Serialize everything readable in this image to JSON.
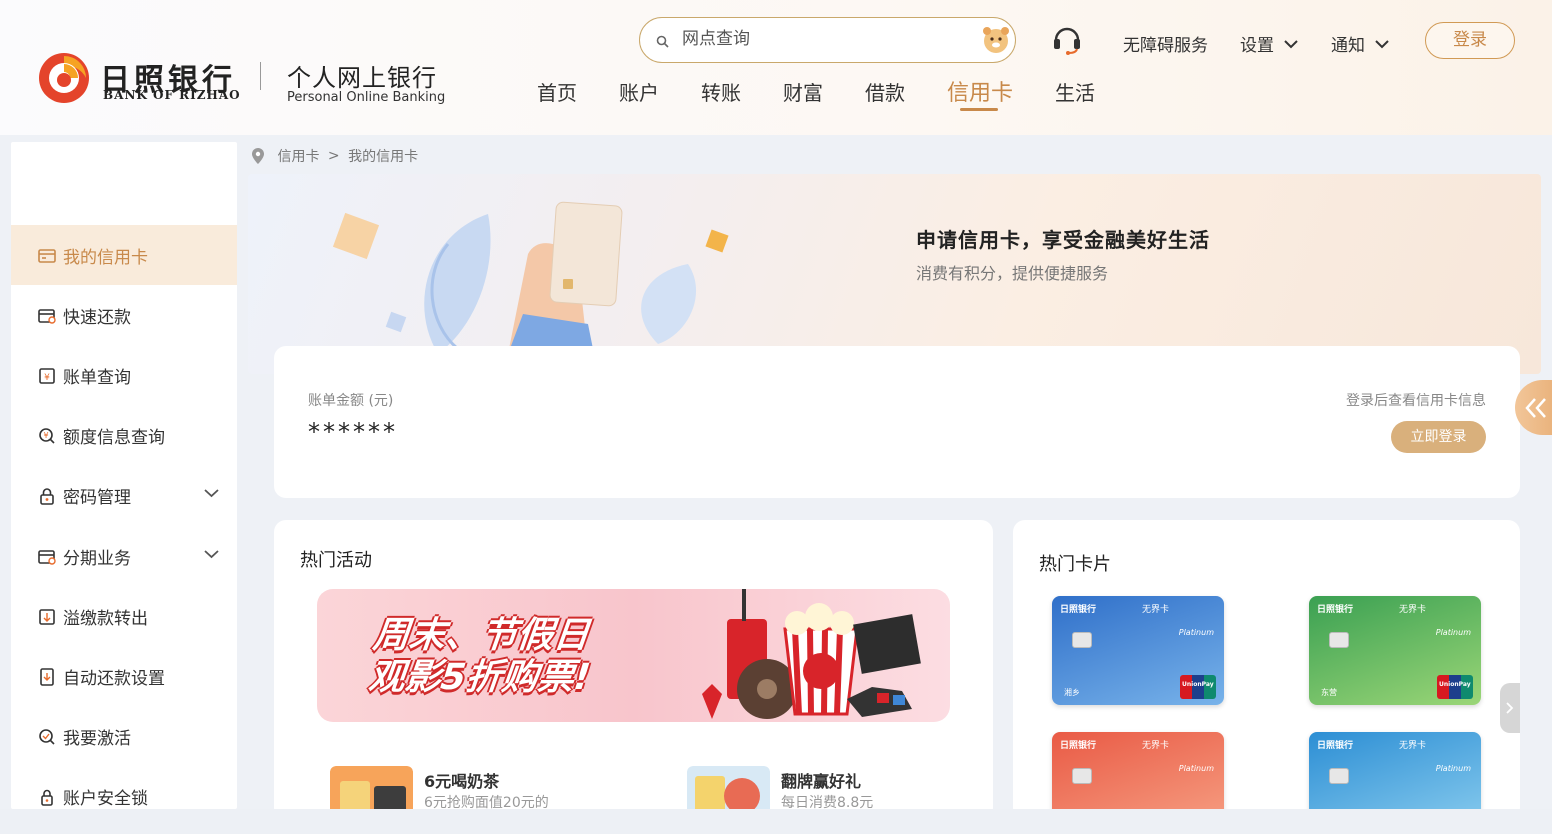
{
  "brand": {
    "name_cn": "日照银行",
    "name_en": "BANK OF RIZHAO",
    "product_cn": "个人网上银行",
    "product_en": "Personal Online Banking"
  },
  "search": {
    "placeholder": "网点查询"
  },
  "top_links": {
    "accessibility": "无障碍服务",
    "settings": "设置",
    "notify": "通知",
    "login": "登录"
  },
  "nav": [
    "首页",
    "账户",
    "转账",
    "财富",
    "借款",
    "信用卡",
    "生活"
  ],
  "nav_active": "信用卡",
  "sidebar": {
    "items": [
      {
        "label": "我的信用卡",
        "icon": "credit-card-icon",
        "active": true
      },
      {
        "label": "快速还款",
        "icon": "repay-icon"
      },
      {
        "label": "账单查询",
        "icon": "bill-icon"
      },
      {
        "label": "额度信息查询",
        "icon": "limit-icon"
      },
      {
        "label": "密码管理",
        "icon": "lock-icon",
        "expandable": true
      },
      {
        "label": "分期业务",
        "icon": "installment-icon",
        "expandable": true
      },
      {
        "label": "溢缴款转出",
        "icon": "transfer-out-icon"
      },
      {
        "label": "自动还款设置",
        "icon": "auto-repay-icon"
      },
      {
        "label": "我要激活",
        "icon": "activate-icon"
      },
      {
        "label": "账户安全锁",
        "icon": "security-lock-icon"
      }
    ]
  },
  "breadcrumb": {
    "level1": "信用卡",
    "sep": ">",
    "level2": "我的信用卡"
  },
  "banner": {
    "title": "申请信用卡，享受金融美好生活",
    "subtitle": "消费有积分，提供便捷服务"
  },
  "bill": {
    "label": "账单金额 (元)",
    "value": "******",
    "hint": "登录后查看信用卡信息",
    "login_button": "立即登录"
  },
  "hot_activities": {
    "title": "热门活动",
    "promo_line1": "周末、节假日",
    "promo_line2": "观影5折购票!",
    "items": [
      {
        "title": "6元喝奶茶",
        "subtitle": "6元抢购面值20元的"
      },
      {
        "title": "翻牌赢好礼",
        "subtitle": "每日消费8.8元"
      }
    ]
  },
  "hot_cards": {
    "title": "热门卡片",
    "cards": [
      {
        "bank": "日照银行",
        "tag": "无界卡",
        "name": "湘乡",
        "colors": [
          "#2f6fc9",
          "#78b3ea"
        ]
      },
      {
        "bank": "日照银行",
        "tag": "无界卡",
        "name": "东营",
        "colors": [
          "#3aa052",
          "#9bd677"
        ]
      },
      {
        "bank": "日照银行",
        "tag": "无界卡",
        "name": "",
        "colors": [
          "#e95a45",
          "#f7a487"
        ]
      },
      {
        "bank": "日照银行",
        "tag": "无界卡",
        "name": "",
        "colors": [
          "#2c8ed4",
          "#8fd0f0"
        ]
      }
    ],
    "platinum": "Platinum",
    "unionpay": "UnionPay"
  },
  "colors": {
    "accent": "#c8894a",
    "active_bg": "#f9ebdb"
  }
}
